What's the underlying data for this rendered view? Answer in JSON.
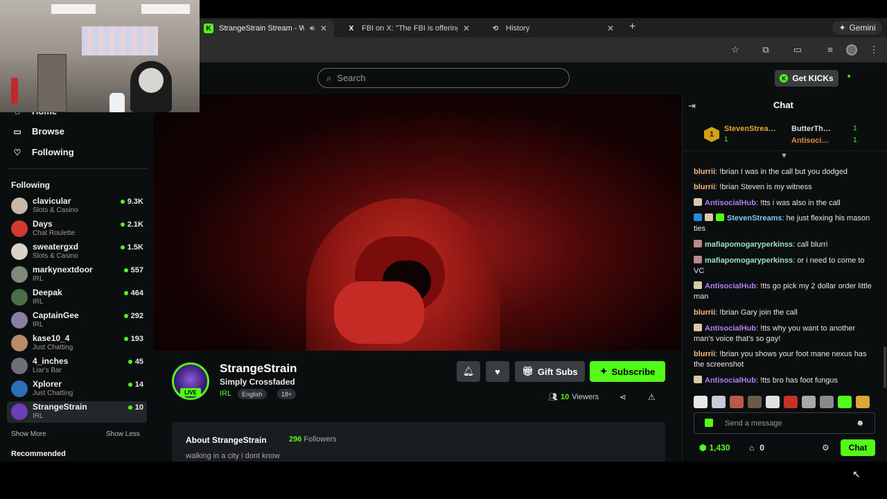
{
  "browser": {
    "tabs": [
      {
        "title": "StrangeStrain Stream - W",
        "favicon": "K",
        "active": true,
        "sound": true
      },
      {
        "title": "FBI on X: \"The FBI is offering",
        "favicon": "X",
        "active": false,
        "sound": false
      },
      {
        "title": "History",
        "favicon": "history-icon",
        "active": false,
        "sound": false
      }
    ],
    "new_tab": "+",
    "gemini_label": "Gemini"
  },
  "header": {
    "search_placeholder": "Search",
    "get_kicks_label": "Get KICKs"
  },
  "sidebar": {
    "nav": [
      {
        "label": "Home",
        "icon": "home-icon"
      },
      {
        "label": "Browse",
        "icon": "browse-icon"
      },
      {
        "label": "Following",
        "icon": "heart-icon"
      }
    ],
    "following_heading": "Following",
    "channels": [
      {
        "name": "clavicular",
        "category": "Slots & Casino",
        "viewers": "9.3K",
        "color": "#c9b8a8"
      },
      {
        "name": "Days",
        "category": "Chat Roulette",
        "viewers": "2.1K",
        "color": "#d23a2f"
      },
      {
        "name": "sweatergxd",
        "category": "Slots & Casino",
        "viewers": "1.5K",
        "color": "#d9d2c8"
      },
      {
        "name": "markynextdoor",
        "category": "IRL",
        "viewers": "557",
        "color": "#7f8a7a"
      },
      {
        "name": "Deepak",
        "category": "IRL",
        "viewers": "464",
        "color": "#4b6d4a"
      },
      {
        "name": "CaptainGee",
        "category": "IRL",
        "viewers": "292",
        "color": "#8a7da8"
      },
      {
        "name": "kase10_4",
        "category": "Just Chatting",
        "viewers": "193",
        "color": "#b88c6a"
      },
      {
        "name": "4_inches",
        "category": "Liar's Bar",
        "viewers": "45",
        "color": "#6f6f78"
      },
      {
        "name": "Xplorer",
        "category": "Just Chatting",
        "viewers": "14",
        "color": "#2a6fb8"
      },
      {
        "name": "StrangeStrain",
        "category": "IRL",
        "viewers": "10",
        "color": "#6a3fb8",
        "selected": true
      }
    ],
    "show_more": "Show More",
    "show_less": "Show Less",
    "recommended_heading": "Recommended"
  },
  "stream": {
    "name": "StrangeStrain",
    "title": "Simply Crossfaded",
    "category": "IRL",
    "tags": [
      "English",
      "18+"
    ],
    "live_label": "LIVE",
    "gift_subs_label": "Gift Subs",
    "subscribe_label": "Subscribe",
    "viewers_count": "10",
    "viewers_label": "Viewers",
    "about_heading": "About StrangeStrain",
    "followers_count": "296",
    "followers_label": "Followers",
    "bio": "walking in a city i dont know"
  },
  "chat": {
    "title": "Chat",
    "gifters": [
      {
        "rank": "1",
        "name": "StevenStrea…",
        "count": "1"
      },
      {
        "name": "ButterTh…",
        "count": "1"
      },
      {
        "name": "Antisoci…",
        "count": "1"
      }
    ],
    "messages": [
      {
        "user": "blurrii",
        "text": "!brian I was in the call but you dodged",
        "color": "#f2b97c"
      },
      {
        "user": "blurrii",
        "text": "!brian Steven is my witness",
        "color": "#f2b97c"
      },
      {
        "user": "AntisocialHub",
        "text": "!tts i was also in the call",
        "color": "#b57cf2"
      },
      {
        "user": "StevenStreams",
        "text": "he just flexing his mason ties",
        "color": "#7cc8f2"
      },
      {
        "user": "mafiapomogaryperkinss",
        "text": "call blurri",
        "color": "#9ae0c8"
      },
      {
        "user": "mafiapomogaryperkinss",
        "text": "or i need to come to VC",
        "color": "#9ae0c8"
      },
      {
        "user": "AntisocialHub",
        "text": "!tts go pick my 2 dollar order little man",
        "color": "#b57cf2"
      },
      {
        "user": "blurrii",
        "text": "!brian Gary join the call",
        "color": "#f2b97c"
      },
      {
        "user": "AntisocialHub",
        "text": "!tts why you want to another man's voice that's so gay!",
        "color": "#b57cf2"
      },
      {
        "user": "blurrii",
        "text": "!brian you shows your foot mane nexus has the screenshot",
        "color": "#f2b97c"
      },
      {
        "user": "AntisocialHub",
        "text": "!tts bro has foot fungus",
        "color": "#b57cf2"
      }
    ],
    "input_placeholder": "Send a message",
    "points": "1,430",
    "store_count": "0",
    "chat_button": "Chat"
  },
  "colors": {
    "accent": "#53fc18",
    "background": "#0b0e0f"
  }
}
